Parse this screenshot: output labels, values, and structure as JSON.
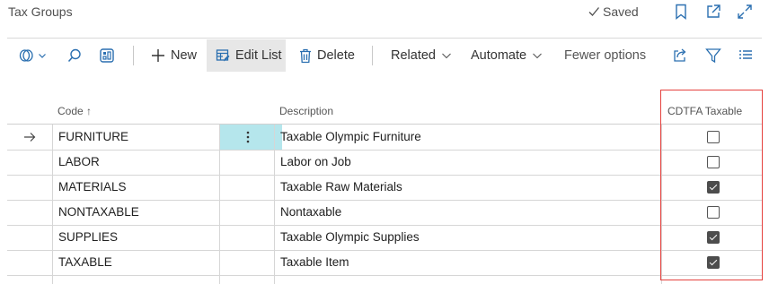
{
  "page": {
    "title": "Tax Groups",
    "status": "Saved"
  },
  "toolbar": {
    "new_label": "New",
    "edit_list_label": "Edit List",
    "delete_label": "Delete",
    "related_label": "Related",
    "automate_label": "Automate",
    "fewer_options_label": "Fewer options"
  },
  "columns": {
    "code": "Code",
    "code_sort": "↑",
    "description": "Description",
    "cdtfa_taxable": "CDTFA Taxable"
  },
  "rows": [
    {
      "code": "FURNITURE",
      "description": "Taxable Olympic Furniture",
      "taxable": false
    },
    {
      "code": "LABOR",
      "description": "Labor on Job",
      "taxable": false
    },
    {
      "code": "MATERIALS",
      "description": "Taxable Raw Materials",
      "taxable": true
    },
    {
      "code": "NONTAXABLE",
      "description": "Nontaxable",
      "taxable": false
    },
    {
      "code": "SUPPLIES",
      "description": "Taxable Olympic Supplies",
      "taxable": true
    },
    {
      "code": "TAXABLE",
      "description": "Taxable Item",
      "taxable": true
    }
  ],
  "colors": {
    "highlight": "#e5413e",
    "selected_cell": "#b5e6ec",
    "accent": "#2a6fb0"
  },
  "icons": {
    "row_indicator": "arrow-right-icon",
    "row_menu": "more-vertical-icon"
  }
}
